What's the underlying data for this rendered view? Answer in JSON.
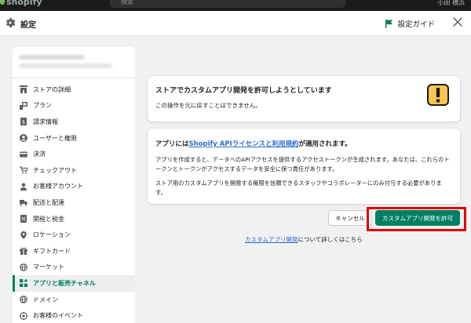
{
  "topbar": {
    "logo": "shopify",
    "search_placeholder": "検索",
    "user": "小田 横浜"
  },
  "modal": {
    "title": "設定",
    "guide": "設定ガイド"
  },
  "sidebar": {
    "items": [
      {
        "label": "ストアの詳細",
        "icon": "store-icon"
      },
      {
        "label": "プラン",
        "icon": "plan-icon"
      },
      {
        "label": "請求情報",
        "icon": "billing-icon"
      },
      {
        "label": "ユーザーと権限",
        "icon": "user-icon"
      },
      {
        "label": "決済",
        "icon": "payment-icon"
      },
      {
        "label": "チェックアウト",
        "icon": "cart-icon"
      },
      {
        "label": "お客様アカウント",
        "icon": "customer-icon"
      },
      {
        "label": "配送と配達",
        "icon": "truck-icon"
      },
      {
        "label": "関税と税金",
        "icon": "tax-icon"
      },
      {
        "label": "ロケーション",
        "icon": "location-icon"
      },
      {
        "label": "ギフトカード",
        "icon": "gift-icon"
      },
      {
        "label": "マーケット",
        "icon": "globe-icon"
      },
      {
        "label": "アプリと販売チャネル",
        "icon": "apps-icon",
        "active": true
      },
      {
        "label": "ドメイン",
        "icon": "domain-icon"
      },
      {
        "label": "お客様のイベント",
        "icon": "event-icon"
      }
    ]
  },
  "card1": {
    "heading": "ストアでカスタムアプリ開発を許可しようとしています",
    "text": "この操作を元に戻すことはできません。"
  },
  "card2": {
    "heading_pre": "アプリには",
    "heading_link": "Shopify APIライセンスと利用規約",
    "heading_post": "が適用されます。",
    "p1": "アプリを作成すると、データへのAPIアクセスを提供するアクセストークンが生成されます。あなたは、これらのトークンとトークンがアクセスするデータを安全に保つ責任があります。",
    "p2": "ストア用のカスタムアプリを開発する権限を信頼できるスタッフやコラボレーターにのみ付与する必要があります。"
  },
  "actions": {
    "cancel": "キャンセル",
    "allow": "カスタムアプリ開発を許可"
  },
  "learn": {
    "link": "カスタムアプリ開発",
    "suffix": "について詳しくはこちら"
  },
  "colors": {
    "primary": "#008060",
    "link": "#2c6ecb",
    "highlight": "#e00000",
    "warning": "#ffc453"
  }
}
